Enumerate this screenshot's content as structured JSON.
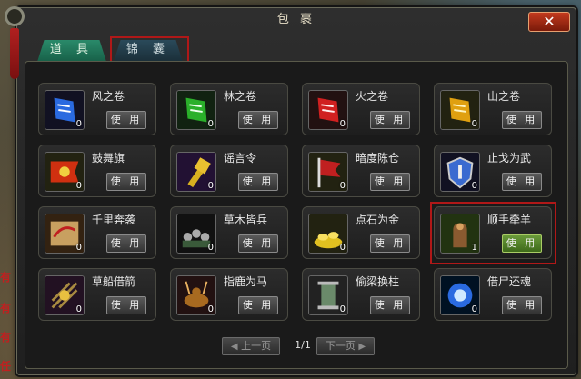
{
  "window": {
    "title": "包 裹",
    "close_label": "✕"
  },
  "tabs": [
    {
      "label": "道 具",
      "active": true
    },
    {
      "label": "锦 囊",
      "active": false
    }
  ],
  "items": [
    {
      "name": "风之卷",
      "count": "0",
      "button": "使 用",
      "icon": "blue-scroll-icon",
      "color": "#2a6ae0"
    },
    {
      "name": "林之卷",
      "count": "0",
      "button": "使 用",
      "icon": "green-scroll-icon",
      "color": "#2ab02a"
    },
    {
      "name": "火之卷",
      "count": "0",
      "button": "使 用",
      "icon": "red-scroll-icon",
      "color": "#d02020"
    },
    {
      "name": "山之卷",
      "count": "0",
      "button": "使 用",
      "icon": "gold-scroll-icon",
      "color": "#e0a010"
    },
    {
      "name": "鼓舞旗",
      "count": "0",
      "button": "使 用",
      "icon": "banner-icon",
      "color": "#d03010"
    },
    {
      "name": "谣言令",
      "count": "0",
      "button": "使 用",
      "icon": "token-icon",
      "color": "#d8b020"
    },
    {
      "name": "暗度陈仓",
      "count": "0",
      "button": "使 用",
      "icon": "flag-icon",
      "color": "#c02020"
    },
    {
      "name": "止戈为武",
      "count": "0",
      "button": "使 用",
      "icon": "shield-icon",
      "color": "#3a6ad0"
    },
    {
      "name": "千里奔袭",
      "count": "0",
      "button": "使 用",
      "icon": "map-icon",
      "color": "#c8a060"
    },
    {
      "name": "草木皆兵",
      "count": "0",
      "button": "使 用",
      "icon": "soldiers-icon",
      "color": "#3a5a3a"
    },
    {
      "name": "点石为金",
      "count": "0",
      "button": "使 用",
      "icon": "gold-pile-icon",
      "color": "#e0c020"
    },
    {
      "name": "顺手牵羊",
      "count": "1",
      "button": "使 用",
      "icon": "hand-icon",
      "color": "#8a5a30"
    },
    {
      "name": "草船借箭",
      "count": "0",
      "button": "使 用",
      "icon": "arrows-icon",
      "color": "#a88a40"
    },
    {
      "name": "指鹿为马",
      "count": "0",
      "button": "使 用",
      "icon": "deer-icon",
      "color": "#a86a20"
    },
    {
      "name": "偷梁换柱",
      "count": "0",
      "button": "使 用",
      "icon": "pillar-icon",
      "color": "#6a8a6a"
    },
    {
      "name": "借尸还魂",
      "count": "0",
      "button": "使 用",
      "icon": "spirit-icon",
      "color": "#2a6ae0"
    }
  ],
  "pager": {
    "prev": "上一页",
    "next": "下一页",
    "page": "1/1"
  },
  "world": {
    "side_text": [
      "有",
      "有",
      "有",
      "任"
    ]
  }
}
